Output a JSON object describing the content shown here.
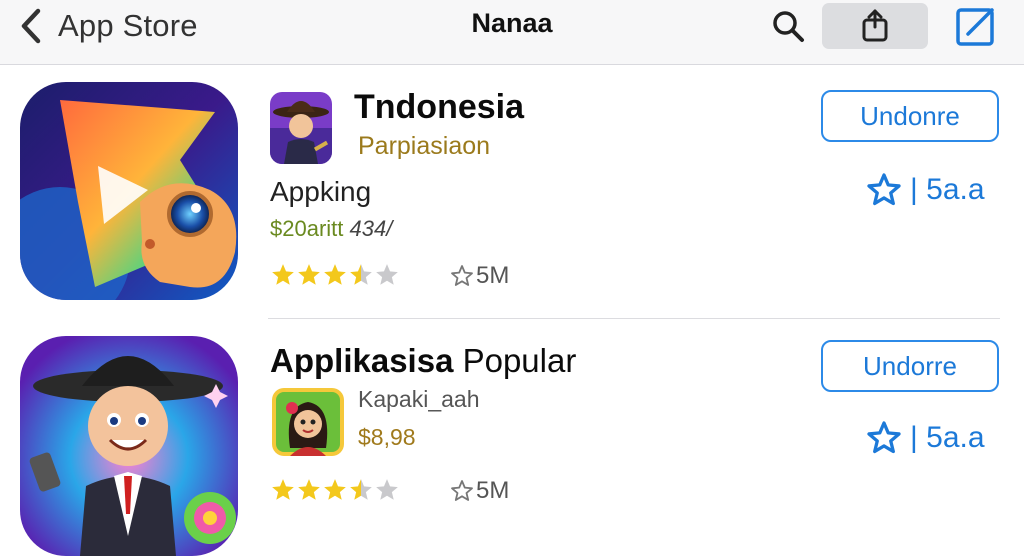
{
  "navbar": {
    "back_label": "App Store",
    "title": "Nanaa",
    "icons": [
      "chevron-left-icon",
      "search-icon",
      "share-icon",
      "compose-icon"
    ]
  },
  "apps": [
    {
      "title": "Tndonesia",
      "subtitle": "Parpiasiaon",
      "name": "Appking",
      "price_main": "$20aritt",
      "price_extra": "434/",
      "rating_stars": 3.5,
      "rating_count": "5M",
      "get_label": "Undonre",
      "fav_label": "| 5a.a"
    },
    {
      "title_bold": "Applikasisa",
      "title_light": "Popular",
      "subtitle": "Kapaki_aah",
      "price": "$8,98",
      "rating_stars": 3.5,
      "rating_count": "5M",
      "get_label": "Undorre",
      "fav_label": "| 5a.a"
    }
  ],
  "colors": {
    "accent": "#1c79d8",
    "star": "#f3c81c",
    "star_empty": "#c9c9cc",
    "gold_text": "#9b7a1c"
  }
}
